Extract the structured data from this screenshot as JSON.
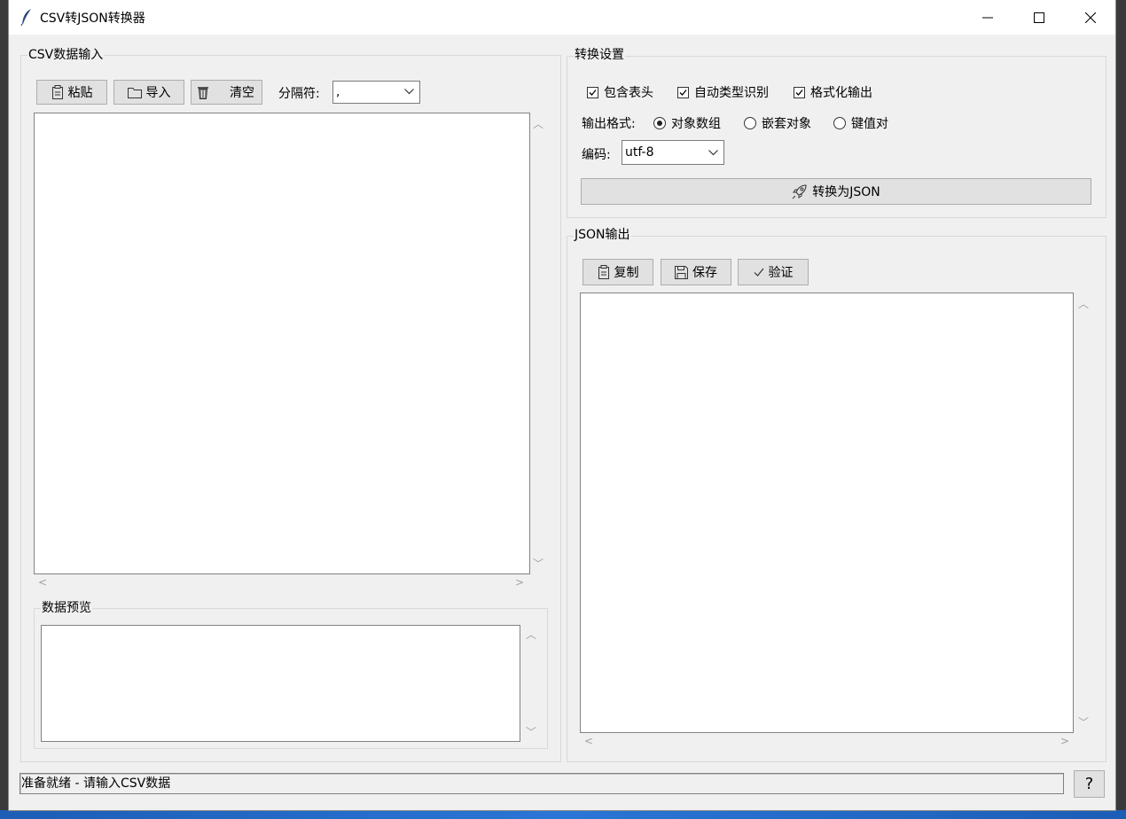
{
  "window": {
    "title": "CSV转JSON转换器",
    "minimize_icon": "minimize-icon",
    "maximize_icon": "maximize-icon",
    "close_icon": "close-icon"
  },
  "csv_input": {
    "group_label": "CSV数据输入",
    "paste_label": "粘贴",
    "import_label": "导入",
    "clear_label": "清空",
    "delimiter_label": "分隔符:",
    "delimiter_value": ",",
    "text": ""
  },
  "preview": {
    "group_label": "数据预览",
    "text": ""
  },
  "settings": {
    "group_label": "转换设置",
    "checks": [
      {
        "label": "包含表头",
        "checked": true
      },
      {
        "label": "自动类型识别",
        "checked": true
      },
      {
        "label": "格式化输出",
        "checked": true
      }
    ],
    "format_label": "输出格式:",
    "formats": [
      {
        "label": "对象数组",
        "selected": true
      },
      {
        "label": "嵌套对象",
        "selected": false
      },
      {
        "label": "键值对",
        "selected": false
      }
    ],
    "encoding_label": "编码:",
    "encoding_value": "utf-8",
    "convert_label": "转换为JSON"
  },
  "json_output": {
    "group_label": "JSON输出",
    "copy_label": "复制",
    "save_label": "保存",
    "validate_label": "验证",
    "text": ""
  },
  "status": {
    "text": "准备就绪 - 请输入CSV数据",
    "help_label": "?"
  }
}
